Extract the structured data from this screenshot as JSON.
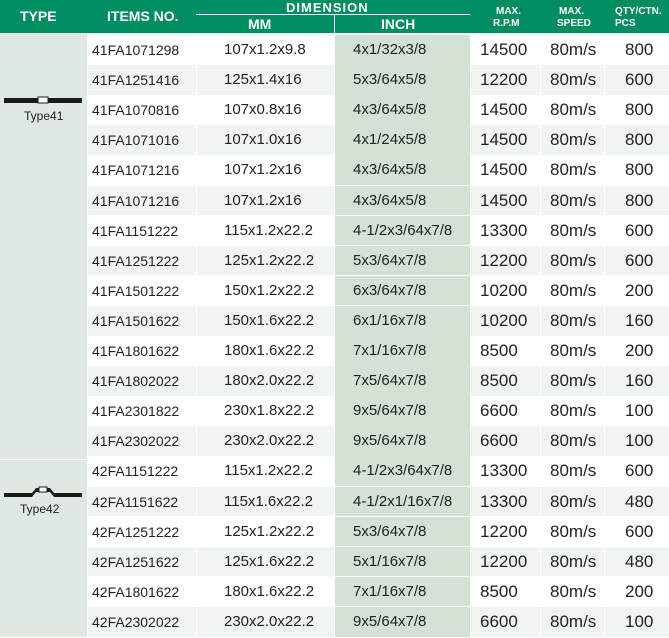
{
  "header": {
    "type": "TYPE",
    "items_no": "ITEMS NO.",
    "dimension": "DIMENSION",
    "mm": "MM",
    "inch": "INCH",
    "max_rpm_1": "MAX.",
    "max_rpm_2": "R.P.M",
    "max_speed_1": "MAX.",
    "max_speed_2": "SPEED",
    "qty_1": "QTY/CTN.",
    "qty_2": "PCS"
  },
  "colors": {
    "header_bg": "#008d5f",
    "type_col_bg": "#dfe9e1",
    "inch_col_bg": "#d4e2d6"
  },
  "groups": [
    {
      "label": "Type41",
      "icon": "flat-disc-icon"
    },
    {
      "label": "Type42",
      "icon": "depressed-center-disc-icon"
    }
  ],
  "rows": [
    {
      "item": "41FA1071298",
      "mm": "107x1.2x9.8",
      "inch": "4x1/32x3/8",
      "rpm": "14500",
      "speed": "80m/s",
      "qty": "800"
    },
    {
      "item": "41FA1251416",
      "mm": "125x1.4x16",
      "inch": "5x3/64x5/8",
      "rpm": "12200",
      "speed": "80m/s",
      "qty": "600"
    },
    {
      "item": "41FA1070816",
      "mm": "107x0.8x16",
      "inch": "4x3/64x5/8",
      "rpm": "14500",
      "speed": "80m/s",
      "qty": "800"
    },
    {
      "item": "41FA1071016",
      "mm": "107x1.0x16",
      "inch": "4x1/24x5/8",
      "rpm": "14500",
      "speed": "80m/s",
      "qty": "800"
    },
    {
      "item": "41FA1071216",
      "mm": "107x1.2x16",
      "inch": "4x3/64x5/8",
      "rpm": "14500",
      "speed": "80m/s",
      "qty": "800"
    },
    {
      "item": "41FA1071216",
      "mm": "107x1.2x16",
      "inch": "4x3/64x5/8",
      "rpm": "14500",
      "speed": "80m/s",
      "qty": "800"
    },
    {
      "item": "41FA1151222",
      "mm": "115x1.2x22.2",
      "inch": "4-1/2x3/64x7/8",
      "rpm": "13300",
      "speed": "80m/s",
      "qty": "600"
    },
    {
      "item": "41FA1251222",
      "mm": "125x1.2x22.2",
      "inch": "5x3/64x7/8",
      "rpm": "12200",
      "speed": "80m/s",
      "qty": "600"
    },
    {
      "item": "41FA1501222",
      "mm": "150x1.2x22.2",
      "inch": "6x3/64x7/8",
      "rpm": "10200",
      "speed": "80m/s",
      "qty": "200"
    },
    {
      "item": "41FA1501622",
      "mm": "150x1.6x22.2",
      "inch": "6x1/16x7/8",
      "rpm": "10200",
      "speed": "80m/s",
      "qty": "160"
    },
    {
      "item": "41FA1801622",
      "mm": "180x1.6x22.2",
      "inch": "7x1/16x7/8",
      "rpm": "8500",
      "speed": "80m/s",
      "qty": "200"
    },
    {
      "item": "41FA1802022",
      "mm": "180x2.0x22.2",
      "inch": "7x5/64x7/8",
      "rpm": "8500",
      "speed": "80m/s",
      "qty": "160"
    },
    {
      "item": "41FA2301822",
      "mm": "230x1.8x22.2",
      "inch": "9x5/64x7/8",
      "rpm": "6600",
      "speed": "80m/s",
      "qty": "100"
    },
    {
      "item": "41FA2302022",
      "mm": "230x2.0x22.2",
      "inch": "9x5/64x7/8",
      "rpm": "6600",
      "speed": "80m/s",
      "qty": "100"
    },
    {
      "item": "42FA1151222",
      "mm": "115x1.2x22.2",
      "inch": "4-1/2x3/64x7/8",
      "rpm": "13300",
      "speed": "80m/s",
      "qty": "600"
    },
    {
      "item": "42FA1151622",
      "mm": "115x1.6x22.2",
      "inch": "4-1/2x1/16x7/8",
      "rpm": "13300",
      "speed": "80m/s",
      "qty": "480"
    },
    {
      "item": "42FA1251222",
      "mm": "125x1.2x22.2",
      "inch": "5x3/64x7/8",
      "rpm": "12200",
      "speed": "80m/s",
      "qty": "600"
    },
    {
      "item": "42FA1251622",
      "mm": "125x1.6x22.2",
      "inch": "5x1/16x7/8",
      "rpm": "12200",
      "speed": "80m/s",
      "qty": "480"
    },
    {
      "item": "42FA1801622",
      "mm": "180x1.6x22.2",
      "inch": "7x1/16x7/8",
      "rpm": "8500",
      "speed": "80m/s",
      "qty": "200"
    },
    {
      "item": "42FA2302022",
      "mm": "230x2.0x22.2",
      "inch": "9x5/64x7/8",
      "rpm": "6600",
      "speed": "80m/s",
      "qty": "100"
    }
  ]
}
